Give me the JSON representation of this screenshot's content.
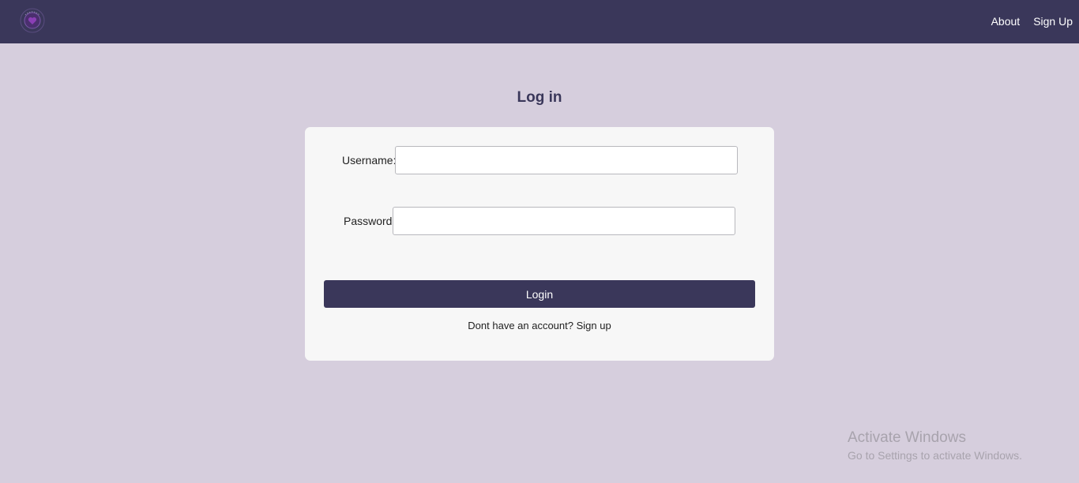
{
  "nav": {
    "about_label": "About",
    "signup_label": "Sign Up"
  },
  "page": {
    "title": "Log in"
  },
  "form": {
    "username_label": "Username:",
    "username_value": "",
    "password_label": "Password:",
    "password_value": "",
    "login_label": "Login",
    "signup_prompt": "Dont have an account?",
    "signup_link": "Sign up"
  },
  "watermark": {
    "title": "Activate Windows",
    "subtitle": "Go to Settings to activate Windows."
  },
  "icons": {
    "logo": "logo-icon"
  },
  "colors": {
    "navbar": "#3a375a",
    "background": "#d6cedd",
    "card": "#f7f7f7",
    "button": "#3a375a",
    "title": "#3a375a"
  }
}
